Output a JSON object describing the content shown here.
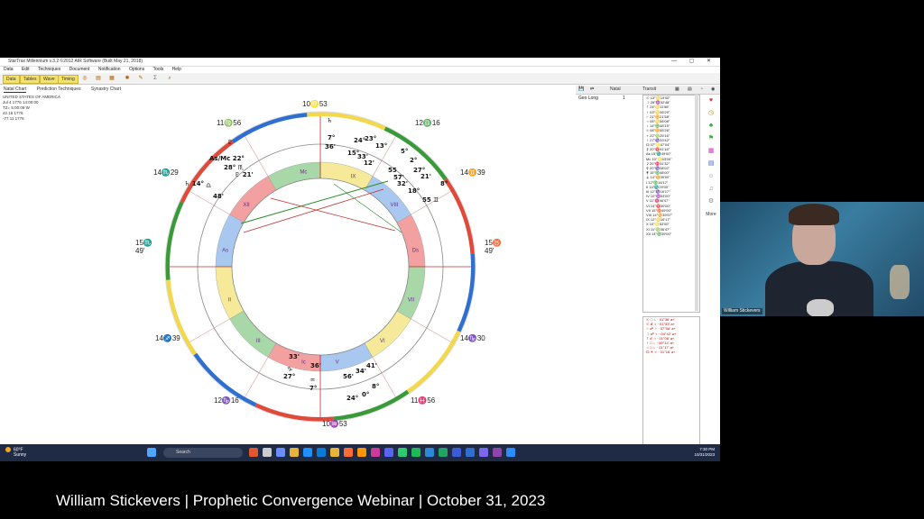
{
  "app": {
    "title": "StarTrax Millennium v.3.2 ©2012 AIR Software (Built May 21, 2018)",
    "menu": [
      "Data",
      "Edit",
      "Techniques",
      "Document",
      "Notification",
      "Options",
      "Tools",
      "Help"
    ],
    "toolbar_buttons": [
      "Data",
      "Tables",
      "Wave",
      "Timing"
    ],
    "chart_tabs": [
      "Natal Chart",
      "Prediction Techniques",
      "Synastry Chart"
    ]
  },
  "chart_info": {
    "name": "UNITED STATES OF AMERICA",
    "date": "Jul 4 1776 14:00:00",
    "tz": "TZ= 5:00:09 W",
    "coord1": "42.16 1776",
    "coord2": "-77.11 1776"
  },
  "wheel": {
    "cusps": [
      {
        "label": "10♌53",
        "key": "mc"
      },
      {
        "label": "11♍56",
        "key": "c11"
      },
      {
        "label": "12♎16",
        "key": "c12"
      },
      {
        "label": "14♏29",
        "key": "c13"
      },
      {
        "label": "14♊39",
        "key": "c14"
      },
      {
        "label": "15♏\n49'",
        "key": "asc"
      },
      {
        "label": "15♉\n49'",
        "key": "dsc"
      },
      {
        "label": "14♐39",
        "key": "c2"
      },
      {
        "label": "14♑30",
        "key": "c8"
      },
      {
        "label": "12♑16",
        "key": "c3"
      },
      {
        "label": "11♓56",
        "key": "c5"
      },
      {
        "label": "10♒53",
        "key": "ic"
      }
    ],
    "houses": [
      "Mc",
      "IX",
      "VIII",
      "Ds",
      "VII",
      "VI",
      "V",
      "Ic",
      "III",
      "II",
      "As",
      "XII",
      "XI",
      "X"
    ],
    "glyphs": [
      {
        "t": "♇"
      },
      {
        "t": "As/Mc 22°"
      },
      {
        "t": "28° ♏"
      },
      {
        "t": "♇ 21'"
      },
      {
        "t": "♄ 14°"
      },
      {
        "t": "♎"
      },
      {
        "t": "48'"
      },
      {
        "t": "♄"
      },
      {
        "t": "7°"
      },
      {
        "t": "36'"
      },
      {
        "t": "24°"
      },
      {
        "t": "23°"
      },
      {
        "t": "13°"
      },
      {
        "t": "15°"
      },
      {
        "t": "33'"
      },
      {
        "t": "12'"
      },
      {
        "t": "5°"
      },
      {
        "t": "2°"
      },
      {
        "t": "55"
      },
      {
        "t": "27°"
      },
      {
        "t": "57'"
      },
      {
        "t": "32'"
      },
      {
        "t": "21'"
      },
      {
        "t": "18°"
      },
      {
        "t": "8°"
      },
      {
        "t": "55 ♊"
      },
      {
        "t": "33'"
      },
      {
        "t": "♑"
      },
      {
        "t": "27°"
      },
      {
        "t": "36'"
      },
      {
        "t": "♒"
      },
      {
        "t": "7°"
      },
      {
        "t": "56'"
      },
      {
        "t": "34'"
      },
      {
        "t": "41'"
      },
      {
        "t": "24°"
      },
      {
        "t": "0°"
      },
      {
        "t": "8°"
      }
    ]
  },
  "right_panel": {
    "toolbar": [
      "Natal",
      "Transit"
    ],
    "selector_label": "Geo Long",
    "selector_value": "1",
    "positions": [
      "☉ 13°♋19'00\"",
      "☽ 28°♒52'48\"",
      "☿ 24°♋11'58\"",
      "♀ 03°♋06'29\"",
      "♂ 21°♊21'58\"",
      "♃ 05°♋56'08\"",
      "♄ 14°♎48'15\"",
      "♅ 08°♊55'26\"",
      "♆ 22°♍25'16\"",
      "♇ 27°♑33'42\"",
      "☊ 07°♌07'04\"",
      "⚷ 20°♈41'16\"",
      "As 15°♏49'00\"",
      "Mc 10°♌53'00\"",
      "⚳ 20°♓31'32\"",
      "⚴ 20°♑08'02\"",
      "⚵ 15°♎48'00\"",
      "⚶ 14°♊39'00\"",
      "I 12°♎16'17\"",
      "II 14°♏29'00\"",
      "III 12°♑16'17\"",
      "IV 10°♒53'00\"",
      "V 11°♓56'47\"",
      "VI 14°♈30'00\"",
      "VII 15°♉49'00\"",
      "VIII 14°♊39'57\"",
      "IX 12°♋16'17\"",
      "X 10°♌53'00\"",
      "XI 11°♍56'47\"",
      "XII 14°♎39'00\""
    ],
    "aspects": [
      "☉ □ ♄ · 01°36' a+",
      "☉ ☌ ♃ · 01°53' a+",
      "♂ ☍ ♇ · 07°06' a+",
      "☽ ☍ ♆ · 04°42' a+",
      "☿ ☌ ♃ · 01°06' a+",
      "♀ □ ♄ · 00°14' a+",
      "♃ □ ♄ · 01°17' a+",
      "☊ ✶ ♅ · 01°16' a+"
    ],
    "side_icons": [
      "heart-icon",
      "clock-icon",
      "tree-icon",
      "flag-icon",
      "chart-icon",
      "grid-icon",
      "people-icon",
      "bell-icon",
      "gear-icon"
    ],
    "more_label": "More"
  },
  "taskbar": {
    "temp": "60°F",
    "weather": "Sunny",
    "search": "Search",
    "time": "7:30 PM",
    "date": "10/31/2023"
  },
  "webcam": {
    "name": "William Stickevers"
  },
  "caption": "William Stickevers  |  Prophetic Convergence Webinar   |  October 31, 2023",
  "colors": {
    "fire": "#e04a3a",
    "earth": "#3a9a3a",
    "air": "#f2d84a",
    "water": "#2f6fd0"
  }
}
